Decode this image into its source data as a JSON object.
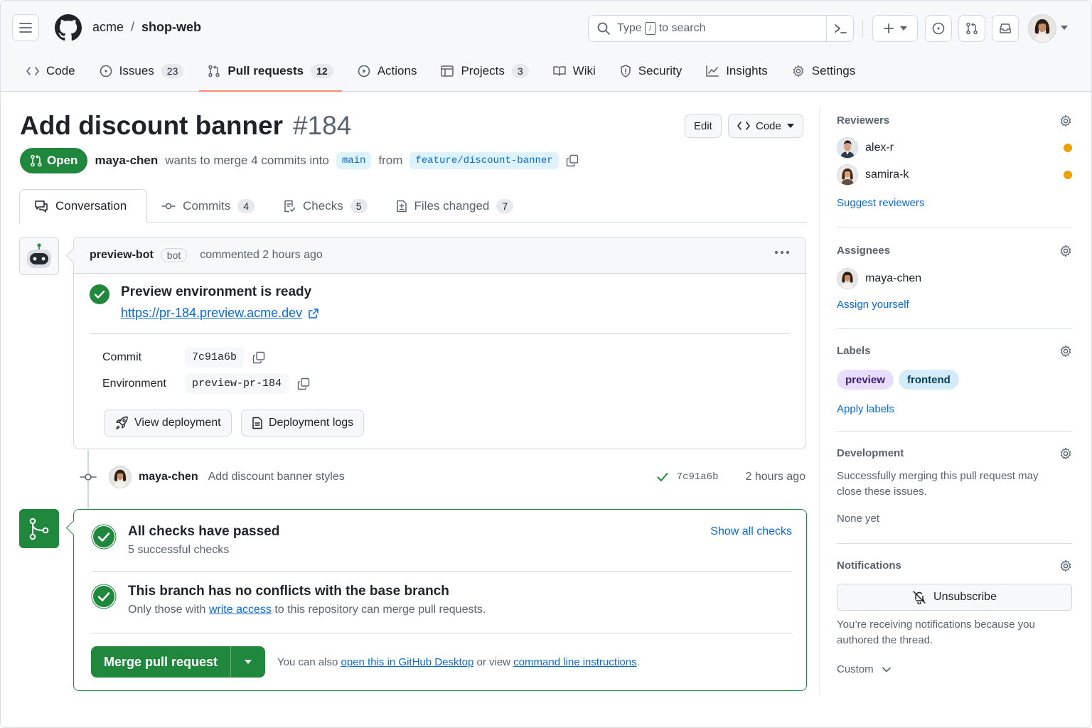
{
  "header": {
    "owner": "acme",
    "separator": "/",
    "repo": "shop-web",
    "search_prefix": "Type",
    "search_key": "/",
    "search_suffix": "to search"
  },
  "nav": [
    {
      "label": "Code",
      "icon": "code-icon"
    },
    {
      "label": "Issues",
      "count": "23",
      "icon": "issue-icon"
    },
    {
      "label": "Pull requests",
      "count": "12",
      "icon": "pull-request-icon",
      "active": true
    },
    {
      "label": "Actions",
      "icon": "play-icon"
    },
    {
      "label": "Projects",
      "count": "3",
      "icon": "table-icon"
    },
    {
      "label": "Wiki",
      "icon": "book-icon"
    },
    {
      "label": "Security",
      "icon": "shield-icon"
    },
    {
      "label": "Insights",
      "icon": "graph-icon"
    },
    {
      "label": "Settings",
      "icon": "gear-icon"
    }
  ],
  "pr": {
    "title": "Add discount banner",
    "number": "#184",
    "edit_label": "Edit",
    "code_label": "Code",
    "state": "Open",
    "author": "maya-chen",
    "merge_text": "wants to merge 4 commits into",
    "base_branch": "main",
    "from_text": "from",
    "head_branch": "feature/discount-banner"
  },
  "tabs": [
    {
      "label": "Conversation",
      "active": true
    },
    {
      "label": "Commits",
      "count": "4"
    },
    {
      "label": "Checks",
      "count": "5"
    },
    {
      "label": "Files changed",
      "count": "7"
    }
  ],
  "bot_comment": {
    "author": "preview-bot",
    "badge": "bot",
    "time": "commented 2 hours ago",
    "heading": "Preview environment is ready",
    "url": "https://pr-184.preview.acme.dev",
    "commit_label": "Commit",
    "commit_value": "7c91a6b",
    "env_label": "Environment",
    "env_value": "preview-pr-184",
    "view_deploy": "View deployment",
    "deploy_logs": "Deployment logs"
  },
  "commit_event": {
    "author": "maya-chen",
    "message": "Add discount banner styles",
    "sha": "7c91a6b",
    "time": "2 hours ago"
  },
  "merge": {
    "checks_title": "All checks have passed",
    "checks_sub": "5 successful checks",
    "show_all": "Show all checks",
    "conflict_title": "This branch has no conflicts with the base branch",
    "conflict_sub_pre": "Only those with",
    "conflict_sub_link": "write access",
    "conflict_sub_post": "to this repository can merge pull requests.",
    "button": "Merge pull request",
    "also_pre": "You can also",
    "also_link1": "open this in GitHub Desktop",
    "also_mid": "or view",
    "also_link2": "command line instructions",
    "also_end": "."
  },
  "sidebar": {
    "reviewers_title": "Reviewers",
    "reviewers": [
      {
        "name": "alex-r",
        "status_color": "#f0a000"
      },
      {
        "name": "samira-k",
        "status_color": "#f0a000"
      }
    ],
    "suggest": "Suggest reviewers",
    "assignees_title": "Assignees",
    "assignee": "maya-chen",
    "assign_yourself": "Assign yourself",
    "labels_title": "Labels",
    "labels": [
      {
        "name": "preview",
        "bg": "#e8ddfb",
        "fg": "#3b1f73"
      },
      {
        "name": "frontend",
        "bg": "#d3ecfa",
        "fg": "#0b3b59"
      }
    ],
    "apply_labels": "Apply labels",
    "development_title": "Development",
    "development_text": "Successfully merging this pull request may close these issues.",
    "none_yet": "None yet",
    "notifications_title": "Notifications",
    "unsubscribe": "Unsubscribe",
    "notif_reason": "You’re receiving notifications because you authored the thread.",
    "custom": "Custom"
  },
  "colors": {
    "accent_green": "#1f883d",
    "link_blue": "#0969da",
    "tab_underline": "#fd8c73"
  }
}
